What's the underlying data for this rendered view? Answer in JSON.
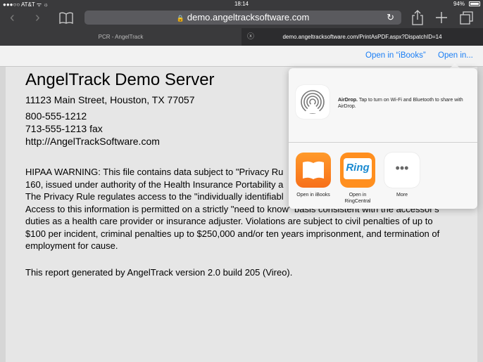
{
  "status_bar": {
    "carrier": "●●●○○ AT&T ᯤ ☼",
    "time": "18:14",
    "battery": "94%"
  },
  "browser": {
    "url": "demo.angeltracksoftware.com",
    "tabs": [
      {
        "label": "PCR - AngelTrack"
      },
      {
        "label": "demo.angeltracksoftware.com/PrintAsPDF.aspx?DispatchID=14"
      }
    ]
  },
  "toolbar": {
    "open_in_ibooks": "Open in “iBooks”",
    "open_in": "Open in..."
  },
  "document": {
    "title": "AngelTrack Demo Server",
    "address": "11123 Main Street, Houston, TX 77057",
    "phone": "800-555-1212",
    "fax": " 713-555-1213 fax",
    "website": " http://AngelTrackSoftware.com",
    "hipaa_lines": [
      "HIPAA WARNING: This file contains data subject to \"Privacy Ru",
      "160, issued under authority of the Health Insurance Portability a",
      "The Privacy Rule regulates access to the \"individually identifiabl",
      "Access to this information is permitted on a strictly \"need to know\" basis consistent with the accessor's",
      "duties as a health care provider or insurance adjuster. Violations are subject to civil penalties of up to",
      "$100 per incident, criminal penalties up to $250,000 and/or ten years imprisonment, and termination of",
      "employment for cause."
    ],
    "generated_by": "This report generated by AngelTrack version 2.0 build 205 (Vireo)."
  },
  "share_sheet": {
    "airdrop_title": "AirDrop.",
    "airdrop_text": " Tap to turn on Wi-Fi and Bluetooth to share with AirDrop.",
    "apps": [
      {
        "label": "Open in iBooks",
        "icon": "ibooks-icon"
      },
      {
        "label": "Open in RingCentral",
        "icon": "ringcentral-icon",
        "icon_text": "Ring"
      },
      {
        "label": "More",
        "icon": "more-icon",
        "icon_text": "•••"
      }
    ]
  }
}
